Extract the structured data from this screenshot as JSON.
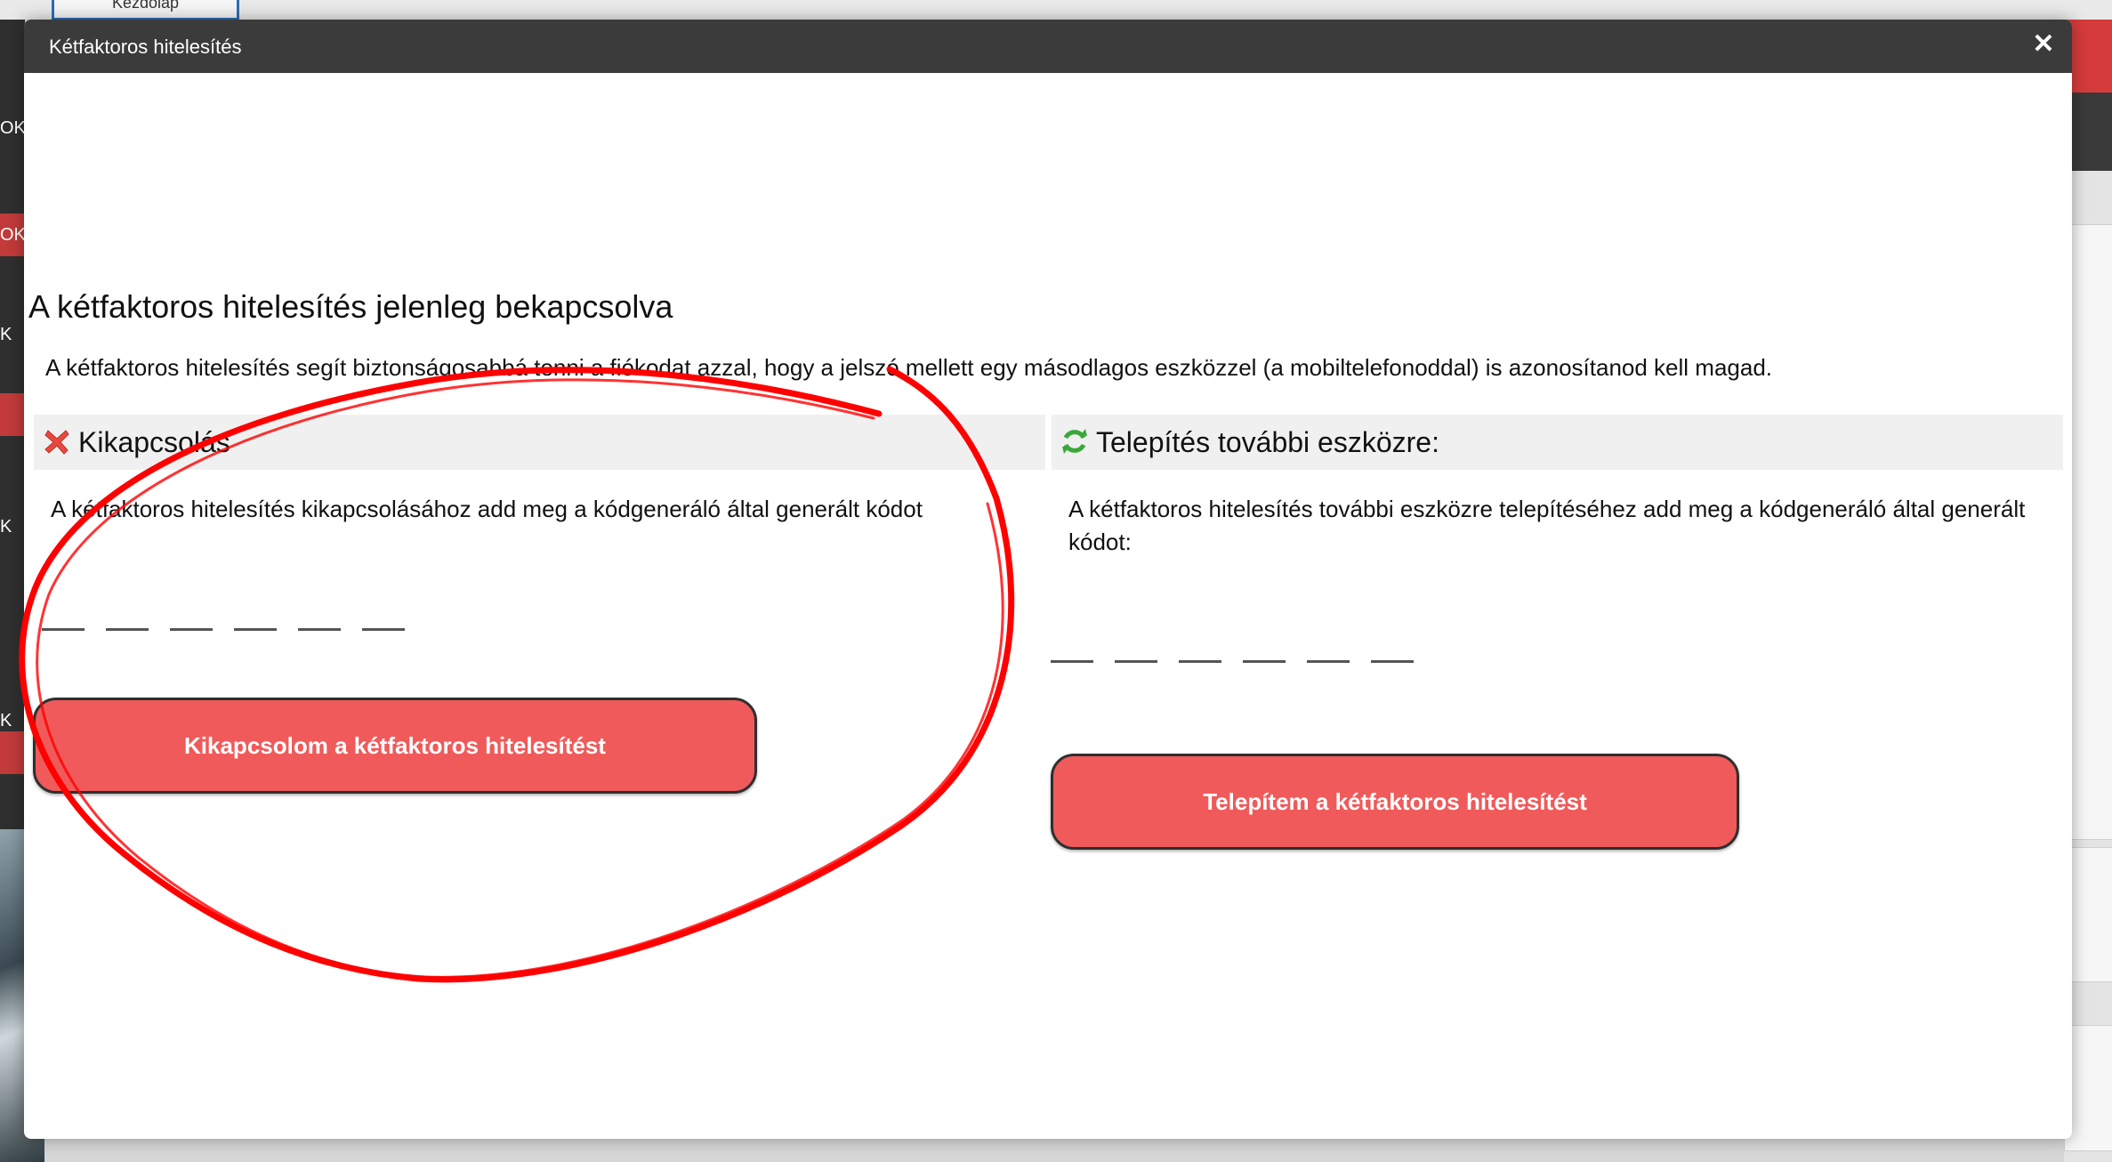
{
  "background": {
    "tab_label": "Kezdőlap",
    "sidebar_fragments": [
      "OK",
      "OK",
      "K",
      "K",
      "K"
    ]
  },
  "modal": {
    "title": "Kétfaktoros hitelesítés",
    "close_glyph": "✕",
    "status_title": "A kétfaktoros hitelesítés jelenleg bekapcsolva",
    "intro": "A kétfaktoros hitelesítés segít biztonságosabbá tenni a fiókodat azzal, hogy a jelszó mellett egy másodlagos eszközzel (a mobiltelefonoddal) is azonosítanod kell magad.",
    "disable": {
      "icon": "red-x-icon",
      "heading": "Kikapcsolás",
      "description": "A kétfaktoros hitelesítés kikapcsolásához add meg a kódgeneráló által generált kódot",
      "code_digits": 6,
      "button_label": "Kikapcsolom a kétfaktoros hitelesítést"
    },
    "install": {
      "icon": "green-refresh-icon",
      "heading": "Telepítés további eszközre:",
      "description": "A kétfaktoros hitelesítés további eszközre telepítéséhez add meg a kódgeneráló által generált kódot:",
      "code_digits": 6,
      "button_label": "Telepítem a kétfaktoros hitelesítést"
    }
  },
  "colors": {
    "header_bg": "#3b3b3b",
    "button_red": "#f05a5a",
    "annotation_red": "#ff0000"
  }
}
